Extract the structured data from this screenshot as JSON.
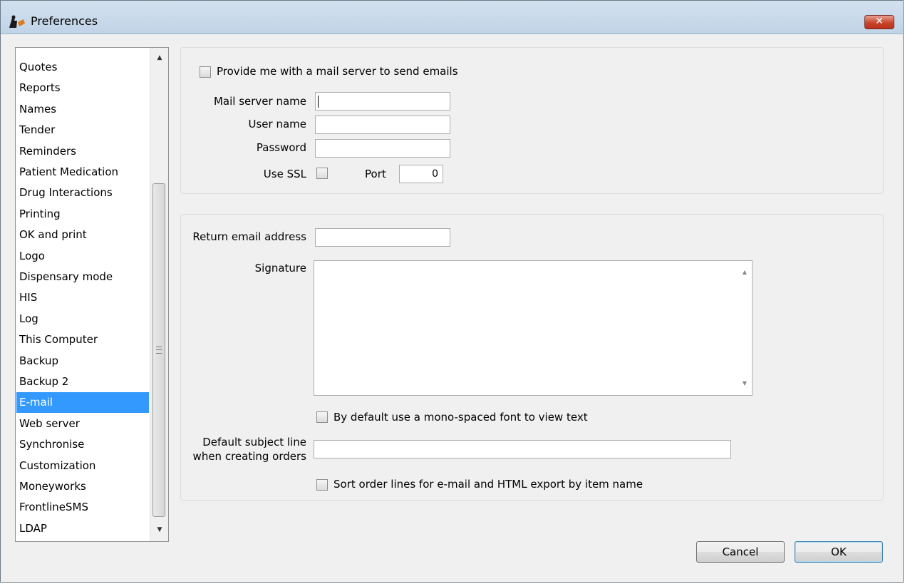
{
  "window": {
    "title": "Preferences",
    "close_label": "✕"
  },
  "sidebar": {
    "items": [
      {
        "label": "Quotes"
      },
      {
        "label": "Reports"
      },
      {
        "label": "Names"
      },
      {
        "label": "Tender"
      },
      {
        "label": "Reminders"
      },
      {
        "label": "Patient Medication"
      },
      {
        "label": "Drug Interactions"
      },
      {
        "label": "Printing"
      },
      {
        "label": "OK and print"
      },
      {
        "label": "Logo"
      },
      {
        "label": "Dispensary mode"
      },
      {
        "label": "HIS"
      },
      {
        "label": "Log"
      },
      {
        "label": "This Computer"
      },
      {
        "label": "Backup"
      },
      {
        "label": "Backup 2"
      },
      {
        "label": "E-mail",
        "selected": true
      },
      {
        "label": "Web server"
      },
      {
        "label": "Synchronise"
      },
      {
        "label": "Customization"
      },
      {
        "label": "Moneyworks"
      },
      {
        "label": "FrontlineSMS"
      },
      {
        "label": "LDAP"
      }
    ]
  },
  "mail_server": {
    "provide_label": "Provide me with a mail server to send emails",
    "provide_checked": false,
    "server_name_label": "Mail server name",
    "server_name_value": "",
    "user_name_label": "User name",
    "user_name_value": "",
    "password_label": "Password",
    "password_value": "",
    "use_ssl_label": "Use SSL",
    "use_ssl_checked": false,
    "port_label": "Port",
    "port_value": "0"
  },
  "email_settings": {
    "return_address_label": "Return email address",
    "return_address_value": "",
    "signature_label": "Signature",
    "signature_value": "",
    "mono_font_label": "By default use a mono-spaced font to view text",
    "mono_font_checked": false,
    "subject_label_line1": "Default subject line",
    "subject_label_line2": "when creating orders",
    "subject_value": "",
    "sort_lines_label": "Sort order lines for e-mail and HTML export by item name",
    "sort_lines_checked": false
  },
  "buttons": {
    "cancel": "Cancel",
    "ok": "OK"
  }
}
